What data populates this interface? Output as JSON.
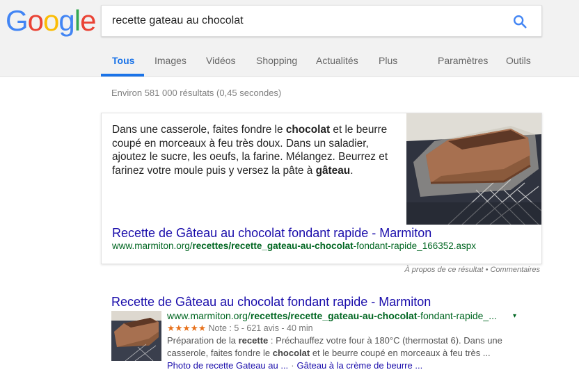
{
  "logo": {
    "letters": [
      "G",
      "o",
      "o",
      "g",
      "l",
      "e"
    ],
    "colors": [
      "#4285F4",
      "#EA4335",
      "#FBBC05",
      "#4285F4",
      "#34A853",
      "#EA4335"
    ]
  },
  "search": {
    "query": "recette gateau au chocolat",
    "icon": "search-icon"
  },
  "tabs": [
    {
      "label": "Tous",
      "active": true
    },
    {
      "label": "Images"
    },
    {
      "label": "Vidéos"
    },
    {
      "label": "Shopping"
    },
    {
      "label": "Actualités"
    },
    {
      "label": "Plus"
    },
    {
      "label": "Paramètres"
    },
    {
      "label": "Outils"
    }
  ],
  "stats": "Environ 581 000 résultats (0,45 secondes)",
  "featured": {
    "t1": "Dans une casserole, faites fondre le ",
    "b1": "chocolat",
    "t2": " et le beurre coupé en morceaux à feu très doux. Dans un saladier, ajoutez le sucre, les oeufs, la farine. Mélangez. Beurrez et farinez votre moule puis y versez la pâte à ",
    "b2": "gâteau",
    "t3": ".",
    "title": "Recette de Gâteau au chocolat fondant rapide - Marmiton",
    "url_1": "www.marmiton.org/",
    "url_2": "recettes/recette_gateau-au-chocolat",
    "url_3": "-fondant-rapide_166352.aspx"
  },
  "about": "À propos de ce résultat • Commentaires",
  "result": {
    "title": "Recette de Gâteau au chocolat fondant rapide - Marmiton",
    "url_1": "www.marmiton.org/",
    "url_2": "recettes/recette_gateau-au-chocolat",
    "url_3": "-fondant-rapide_...",
    "caret": "▾",
    "stars": "★★★★★",
    "rating": " Note : 5 - 621 avis - 40 min",
    "d1": "Préparation de la ",
    "d2": "recette",
    "d3": " : Préchauffez votre four à 180°C (thermostat 6). Dans une casserole, faites fondre le ",
    "d4": "chocolat",
    "d5": " et le beurre coupé en morceaux à feu très ...",
    "link1": "Photo de recette Gateau au ...",
    "sep": "·",
    "link2": "Gâteau à la crème de beurre ..."
  }
}
